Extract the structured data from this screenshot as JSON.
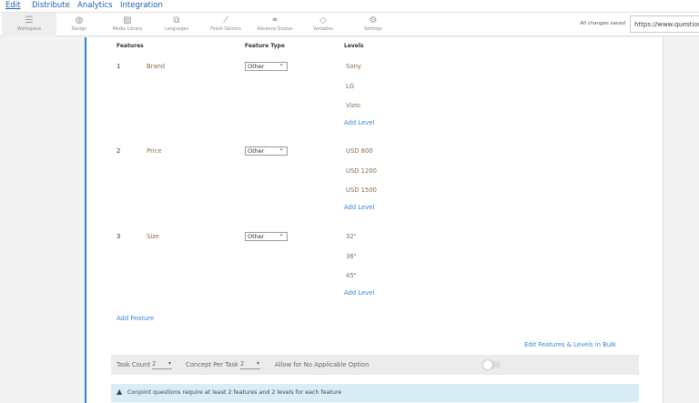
{
  "menu": [
    "Edit",
    "Distribute",
    "Analytics",
    "Integration"
  ],
  "tools": [
    {
      "label": "Workspace",
      "icon": "list-icon"
    },
    {
      "label": "Design",
      "icon": "palette-icon"
    },
    {
      "label": "Media Library",
      "icon": "image-icon"
    },
    {
      "label": "Languages",
      "icon": "translate-icon"
    },
    {
      "label": "Finish Options",
      "icon": "magic-wand-icon"
    },
    {
      "label": "Advance Quotas",
      "icon": "link-icon"
    },
    {
      "label": "Variables",
      "icon": "tag-icon"
    },
    {
      "label": "Settings",
      "icon": "gear-icon"
    }
  ],
  "status": "All changes saved",
  "url": "https://www.questionpro",
  "headers": {
    "features": "Features",
    "type": "Feature Type",
    "levels": "Levels"
  },
  "features": [
    {
      "num": "1",
      "name": "Brand",
      "type": "Other",
      "levels": [
        "Sony",
        "LG",
        "Vizio"
      ]
    },
    {
      "num": "2",
      "name": "Price",
      "type": "Other",
      "levels": [
        "USD 800",
        "USD 1200",
        "USD 1500"
      ]
    },
    {
      "num": "3",
      "name": "Size",
      "type": "Other",
      "levels": [
        "32\"",
        "36\"",
        "45\""
      ]
    }
  ],
  "add_level": "Add Level",
  "add_feature": "Add Feature",
  "bulk_edit": "Edit Features & Levels in Bulk",
  "options": {
    "task_count_label": "Task Count",
    "task_count": "2",
    "concept_label": "Concept Per Task",
    "concept": "2",
    "allow_label": "Allow for No Applicable Option",
    "allow_on": false
  },
  "alert": "Conjoint questions require at least 2 features and 2 levels for each feature"
}
